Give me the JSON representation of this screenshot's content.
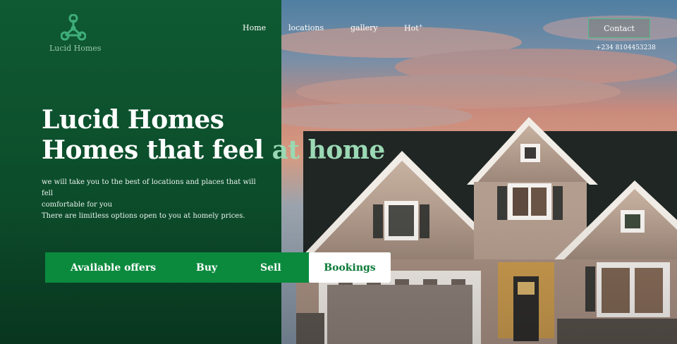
{
  "brand": {
    "name": "Lucid Homes"
  },
  "nav": {
    "items": [
      "Home",
      "locations",
      "gallery",
      "Hot"
    ],
    "hot_badge": "+"
  },
  "contact": {
    "label": "Contact",
    "phone": "+234 8104453238"
  },
  "hero": {
    "title_line1": "Lucid Homes",
    "title_line2_prefix": "Homes that feel ",
    "title_line2_accent": "at home",
    "description": [
      "we will take you to the best of locations and  places that will fell",
      "comfortable for you",
      "There are limitless options open to you at homely prices."
    ]
  },
  "tabs": {
    "items": [
      "Available offers",
      "Buy",
      "Sell",
      "Bookings"
    ],
    "active": "Bookings"
  },
  "colors": {
    "panel_green": "#0f5a32",
    "accent_green": "#0b8a3e",
    "accent_text": "#9ad9b4",
    "logo_green": "#3fae78"
  },
  "icons": {
    "logo": "tri-node-logo-icon"
  }
}
